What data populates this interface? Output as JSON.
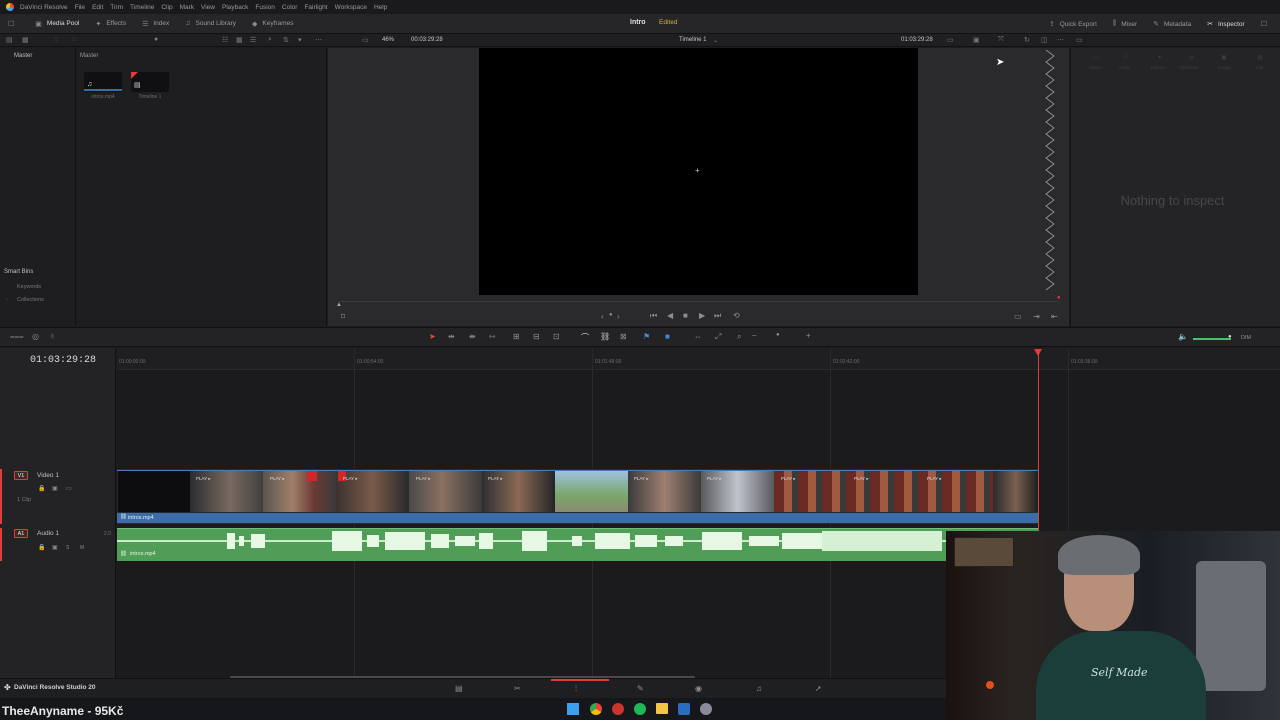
{
  "menubar": {
    "app_name": "DaVinci Resolve",
    "items": [
      "File",
      "Edit",
      "Trim",
      "Timeline",
      "Clip",
      "Mark",
      "View",
      "Playback",
      "Fusion",
      "Color",
      "Fairlight",
      "Workspace",
      "Help"
    ]
  },
  "toolbar": {
    "left": [
      {
        "label": "Media Pool",
        "icon": "media-pool-icon"
      },
      {
        "label": "Effects",
        "icon": "effects-icon"
      },
      {
        "label": "Index",
        "icon": "index-icon"
      },
      {
        "label": "Sound Library",
        "icon": "sound-library-icon"
      },
      {
        "label": "Keyframes",
        "icon": "keyframes-icon"
      }
    ],
    "project_title": "Intro",
    "project_status": "Edited",
    "right": [
      {
        "label": "Quick Export",
        "icon": "quick-export-icon"
      },
      {
        "label": "Mixer",
        "icon": "mixer-icon"
      },
      {
        "label": "Metadata",
        "icon": "metadata-icon"
      },
      {
        "label": "Inspector",
        "icon": "inspector-icon"
      }
    ]
  },
  "subbar": {
    "zoom": "46%",
    "source_timecode": "00:03:29:28",
    "timeline_name": "Timeline 1",
    "viewer_timecode": "01:03:29:28"
  },
  "bins": {
    "master_label": "Master",
    "pool_label": "Master",
    "smart_bins_label": "Smart Bins",
    "smart_items": [
      "Keywords",
      "Collections"
    ]
  },
  "pool_items": [
    {
      "name": "intros.mp4",
      "icon": "music-note-icon"
    },
    {
      "name": "Timeline 1",
      "icon": "timeline-icon"
    }
  ],
  "inspector": {
    "tabs": [
      "Video",
      "Audio",
      "Effects",
      "Transition",
      "Image",
      "File"
    ],
    "empty_text": "Nothing to inspect"
  },
  "timeline": {
    "timecode": "01:03:29:28",
    "ruler": [
      "01:00:00:00",
      "01:00:54:00",
      "01:01:48:00",
      "01:02:42:00",
      "01:03:36:00"
    ],
    "video_track": {
      "tag": "V1",
      "name": "Video 1",
      "clip_count": "1 Clip",
      "clip_name": "intros.mp4"
    },
    "audio_track": {
      "tag": "A1",
      "name": "Audio 1",
      "channels": "2.0",
      "clip_name": "intros.mp4"
    },
    "dim_label": "DIM"
  },
  "thumb_labels": [
    "PLAY ▸",
    "PLAY ▸",
    "PLAY ▸",
    "PLAY ▸",
    "PLAY ▸",
    "PLAY ▸",
    "PLAY ▸",
    "PLAY ▸",
    "PLAY ▸",
    "PLAY ▸"
  ],
  "bottom": {
    "brand": "DaVinci Resolve Studio 20",
    "pages": [
      "media-page-icon",
      "cut-page-icon",
      "edit-page-icon",
      "fusion-page-icon",
      "color-page-icon",
      "fairlight-page-icon",
      "deliver-page-icon"
    ]
  },
  "overlay": {
    "streamer_text": "TheeAnyname - 95Kč",
    "shirt_text": "Self Made"
  },
  "colors": {
    "accent_red": "#e03c3c",
    "video_clip_blue": "#3b6ea8",
    "audio_green": "#4f9d57",
    "edited_yellow": "#d8b03a"
  }
}
